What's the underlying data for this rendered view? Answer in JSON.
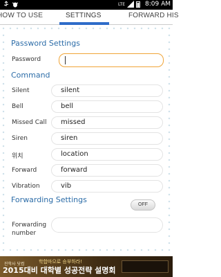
{
  "status_bar": {
    "network": "LTE",
    "signal": "4G",
    "battery_percent": "",
    "time": "8:09 AM",
    "icons": [
      "usb-icon",
      "bug-icon",
      "signal-icon",
      "battery-icon"
    ]
  },
  "tabs": [
    {
      "label": "HOW TO USE",
      "active": false
    },
    {
      "label": "SETTINGS",
      "active": true
    },
    {
      "label": "FORWARD HIS",
      "active": false
    }
  ],
  "colors": {
    "accent": "#2e6cc9",
    "section_title": "#2d6da8",
    "focus_border": "#f0a437"
  },
  "password_settings": {
    "title": "Password Settings",
    "password_label": "Password",
    "password_value": ""
  },
  "command": {
    "title": "Command",
    "rows": [
      {
        "label": "Silent",
        "value": "silent"
      },
      {
        "label": "Bell",
        "value": "bell"
      },
      {
        "label": "Missed Call",
        "value": "missed"
      },
      {
        "label": "Siren",
        "value": "siren"
      },
      {
        "label": "위치",
        "value": "location"
      },
      {
        "label": "Forward",
        "value": "forward"
      },
      {
        "label": "Vibration",
        "value": "vib"
      }
    ]
  },
  "forwarding_settings": {
    "title": "Forwarding Settings",
    "toggle_label": "OFF",
    "number_label_line1": "Forwarding",
    "number_label_line2": "number",
    "number_value": ""
  },
  "ad": {
    "brand": "진학사 닷컴",
    "line1": "학합마으로 승부하라!",
    "line2": "2015대비 대학별 성공전략 설명회",
    "info_line1": "",
    "info_line2": ""
  }
}
